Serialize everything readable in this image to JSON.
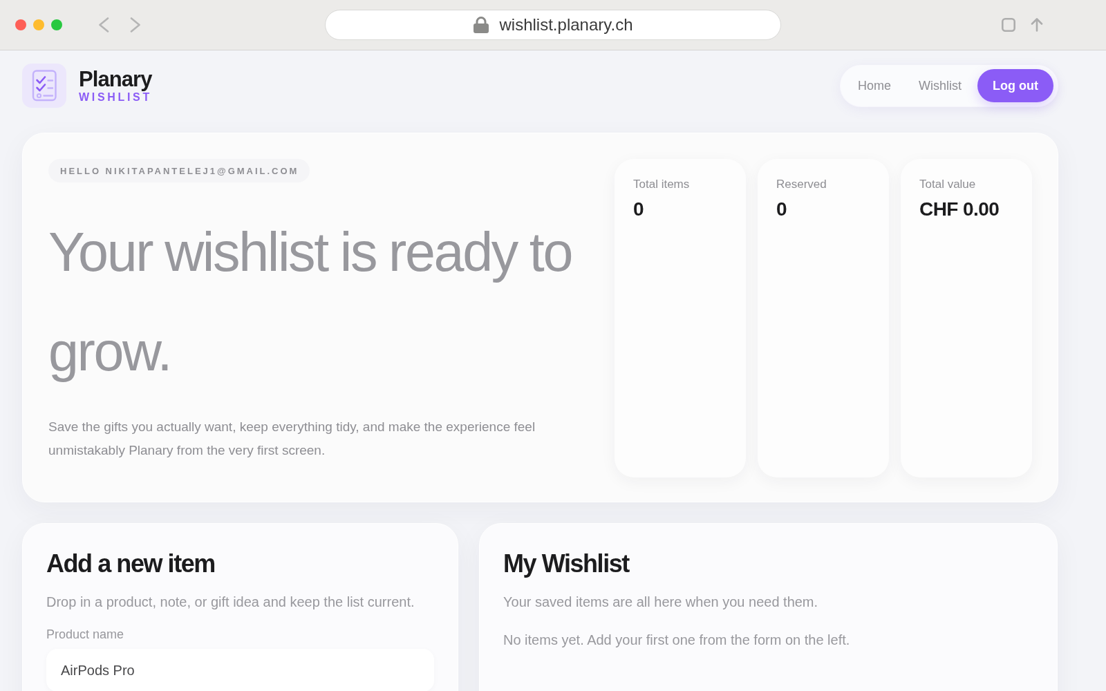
{
  "browser": {
    "url": "wishlist.planary.ch"
  },
  "header": {
    "brand": {
      "name": "Planary",
      "tagline": "WISHLIST"
    },
    "nav": [
      {
        "label": "Home",
        "kind": "link"
      },
      {
        "label": "Wishlist",
        "kind": "link"
      },
      {
        "label": "Log out",
        "kind": "button"
      }
    ]
  },
  "hero": {
    "greeting": "HELLO NIKITAPANTELEJ1@GMAIL.COM",
    "headline": "Your wishlist is ready to grow.",
    "description": "Save the gifts you actually want, keep everything tidy, and make the experience feel unmistakably Planary from the very first screen.",
    "stats": [
      {
        "label": "Total items",
        "value": "0"
      },
      {
        "label": "Reserved",
        "value": "0"
      },
      {
        "label": "Total value",
        "value": "CHF 0.00"
      }
    ]
  },
  "add_item": {
    "title": "Add a new item",
    "subtitle": "Drop in a product, note, or gift idea and keep the list current.",
    "fields": [
      {
        "label": "Product name",
        "value": "AirPods Pro"
      }
    ]
  },
  "wishlist": {
    "title": "My Wishlist",
    "subtitle": "Your saved items are all here when you need them.",
    "empty_message": "No items yet. Add your first one from the form on the left."
  }
}
